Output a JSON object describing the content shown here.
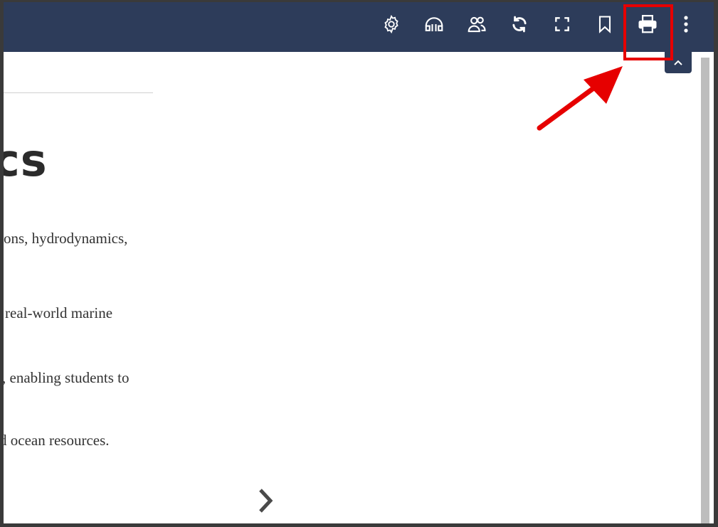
{
  "toolbar": {
    "icons": [
      {
        "name": "settings",
        "label": "Settings"
      },
      {
        "name": "accessibility",
        "label": "Read aloud"
      },
      {
        "name": "users",
        "label": "Share"
      },
      {
        "name": "sync",
        "label": "Sync"
      },
      {
        "name": "fullscreen",
        "label": "Full screen"
      },
      {
        "name": "bookmark",
        "label": "Bookmark"
      },
      {
        "name": "print",
        "label": "Print"
      },
      {
        "name": "more",
        "label": "More options"
      }
    ]
  },
  "content": {
    "heading": "cs",
    "lines": [
      "ons, hydrodynamics,",
      "real-world marine",
      ", enabling students to",
      "d ocean resources."
    ]
  },
  "colors": {
    "toolbar": "#2d3c5a",
    "highlight": "#e60000",
    "arrow": "#e60000"
  }
}
